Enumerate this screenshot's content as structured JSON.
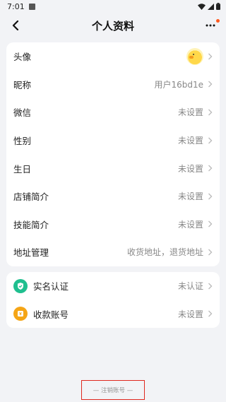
{
  "status_bar": {
    "time": "7:01"
  },
  "header": {
    "title": "个人资料"
  },
  "profile_rows": [
    {
      "label": "头像",
      "value": ""
    },
    {
      "label": "昵称",
      "value": "用户16bd1e"
    },
    {
      "label": "微信",
      "value": "未设置"
    },
    {
      "label": "性别",
      "value": "未设置"
    },
    {
      "label": "生日",
      "value": "未设置"
    },
    {
      "label": "店铺简介",
      "value": "未设置"
    },
    {
      "label": "技能简介",
      "value": "未设置"
    },
    {
      "label": "地址管理",
      "value": "收货地址，退货地址"
    }
  ],
  "account_rows": [
    {
      "label": "实名认证",
      "value": "未认证"
    },
    {
      "label": "收款账号",
      "value": "未设置"
    }
  ],
  "footer": {
    "cancel_label": "— 注销账号 —"
  },
  "colors": {
    "accent_dot": "#ff5a1f",
    "verify_icon": "#1fbf8f",
    "wallet_icon": "#f5a516",
    "highlight_border": "#e0281f"
  }
}
